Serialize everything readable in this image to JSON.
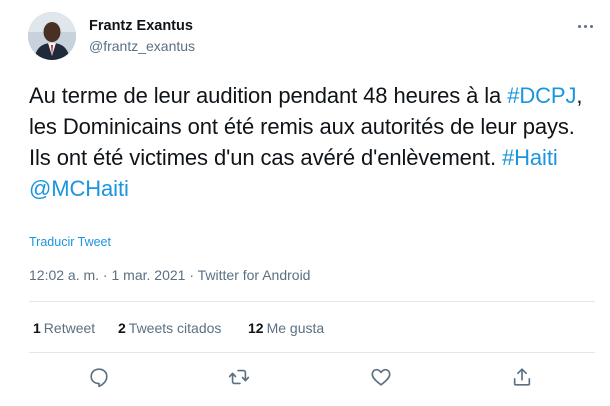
{
  "author": {
    "name": "Frantz Exantus",
    "handle": "@frantz_exantus",
    "avatar_icon": "user-avatar"
  },
  "more_icon": "more-horizontal-icon",
  "tweet": {
    "part1": "Au terme de leur audition pendant 48 heures à la",
    "hashtag1": "#DCPJ",
    "part2": ", les Dominicains ont été remis aux autorités de leur pays. Ils ont été victimes d'un cas avéré d'enlèvement.",
    "hashtag2": "#Haiti",
    "mention": "@MCHaiti"
  },
  "translate_label": "Traducir Tweet",
  "meta": {
    "time": "12:02 a. m.",
    "sep1": " · ",
    "date": "1 mar. 2021",
    "sep2": " · ",
    "source": "Twitter for Android"
  },
  "stats": {
    "retweets_count": "1",
    "retweets_label": "Retweet",
    "quotes_count": "2",
    "quotes_label": "Tweets citados",
    "likes_count": "12",
    "likes_label": "Me gusta"
  },
  "actions": [
    "reply-icon",
    "retweet-icon",
    "like-icon",
    "share-icon"
  ],
  "colors": {
    "link": "#1b95e0",
    "secondary_text": "#5b7083",
    "divider": "#e1e8ed"
  }
}
